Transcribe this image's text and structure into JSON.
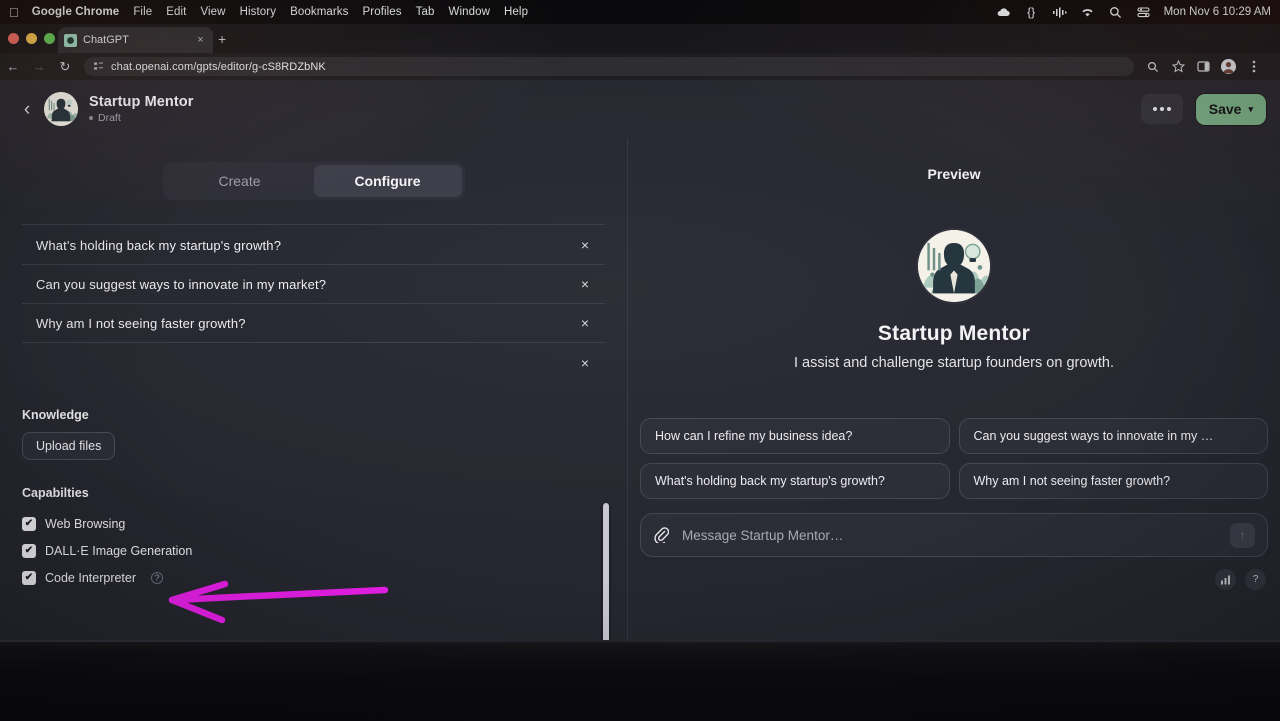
{
  "menubar": {
    "apple": "apple-logo",
    "app": "Google Chrome",
    "items": [
      "File",
      "Edit",
      "View",
      "History",
      "Bookmarks",
      "Profiles",
      "Tab",
      "Window",
      "Help"
    ],
    "status_icons": [
      "cloud-icon",
      "braces-icon",
      "soundwave-icon",
      "wifi-icon",
      "search-icon",
      "control-center-icon"
    ],
    "clock": "Mon Nov 6  10:29 AM"
  },
  "browser": {
    "tab_title": "ChatGPT",
    "tab_close": "×",
    "new_tab": "+",
    "back": "←",
    "forward": "→",
    "reload": "↻",
    "url": "chat.openai.com/gpts/editor/g-cS8RDZbNK",
    "toolbar_icons": [
      "search-icon",
      "bookmark-star-icon",
      "side-panel-icon",
      "profile-avatar",
      "chrome-menu-icon"
    ]
  },
  "header": {
    "back_label": "‹",
    "gpt_name": "Startup Mentor",
    "status": "Draft",
    "more_label": "more-options",
    "save_label": "Save",
    "save_chevron": "▾",
    "save_color": "#77ad84"
  },
  "editor": {
    "tabs": [
      {
        "label": "Create",
        "active": false
      },
      {
        "label": "Configure",
        "active": true
      }
    ],
    "conversation_starters": [
      {
        "text": "What's holding back my startup's growth?",
        "remove": "×"
      },
      {
        "text": "Can you suggest ways to innovate in my market?",
        "remove": "×"
      },
      {
        "text": "Why am I not seeing faster growth?",
        "remove": "×"
      },
      {
        "text": "",
        "remove": "×"
      }
    ],
    "knowledge": {
      "title": "Knowledge",
      "upload_label": "Upload files"
    },
    "capabilities": {
      "title": "Capabilties",
      "items": [
        {
          "label": "Web Browsing",
          "checked": true,
          "check": "✔",
          "help": ""
        },
        {
          "label": "DALL·E Image Generation",
          "checked": true,
          "check": "✔",
          "help": ""
        },
        {
          "label": "Code Interpreter",
          "checked": true,
          "check": "✔",
          "help": "?"
        }
      ]
    }
  },
  "annotation": {
    "type": "hand-drawn-arrow",
    "color": "#e81fe8",
    "direction": "left",
    "points_at": "Web Browsing"
  },
  "preview": {
    "title": "Preview",
    "gpt_name": "Startup Mentor",
    "description": "I assist and challenge startup founders on growth.",
    "suggestions": [
      "How can I refine my business idea?",
      "Can you suggest ways to innovate in my …",
      "What's holding back my startup's growth?",
      "Why am I not seeing faster growth?"
    ],
    "composer": {
      "attach": "paperclip-icon",
      "placeholder": "Message Startup Mentor…",
      "send": "↑"
    },
    "footer_icons": [
      "chart-bar-icon",
      "help-question-icon"
    ],
    "footer_labels": [
      "▐█",
      "?"
    ]
  }
}
